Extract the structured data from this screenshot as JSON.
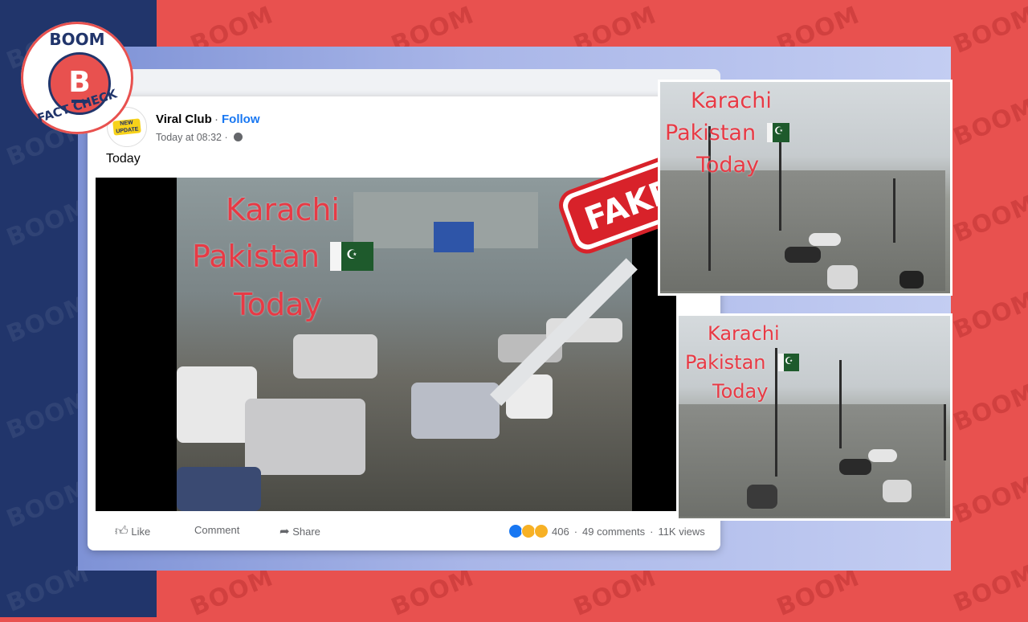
{
  "brand": {
    "badge_top": "BOOM",
    "badge_letter": "B",
    "badge_bottom": "FACT CHECK",
    "watermark": "BOOM",
    "colors": {
      "navy": "#21356b",
      "red": "#e8514f",
      "fb_blue": "#1877f2"
    }
  },
  "post": {
    "page_name": "Viral Club",
    "separator": "·",
    "follow_label": "Follow",
    "timestamp": "Today at 08:32 ·",
    "avatar_badge": "NEW UPDATE",
    "text": "Today"
  },
  "video_overlay": {
    "line1": "Karachi",
    "line2": "Pakistan",
    "line3": "Today"
  },
  "stamp": {
    "label": "FAKE"
  },
  "actions": {
    "like_label": "Like",
    "comment_label": "Comment",
    "share_label": "Share",
    "reaction_count": "406",
    "comments": "49 comments",
    "views": "11K views",
    "dot": "·"
  },
  "icons": [
    "thumbs-up-icon",
    "share-arrow-icon",
    "globe-icon",
    "like-reaction-icon",
    "sad-reaction-icon",
    "wow-reaction-icon",
    "pakistan-flag-icon"
  ]
}
